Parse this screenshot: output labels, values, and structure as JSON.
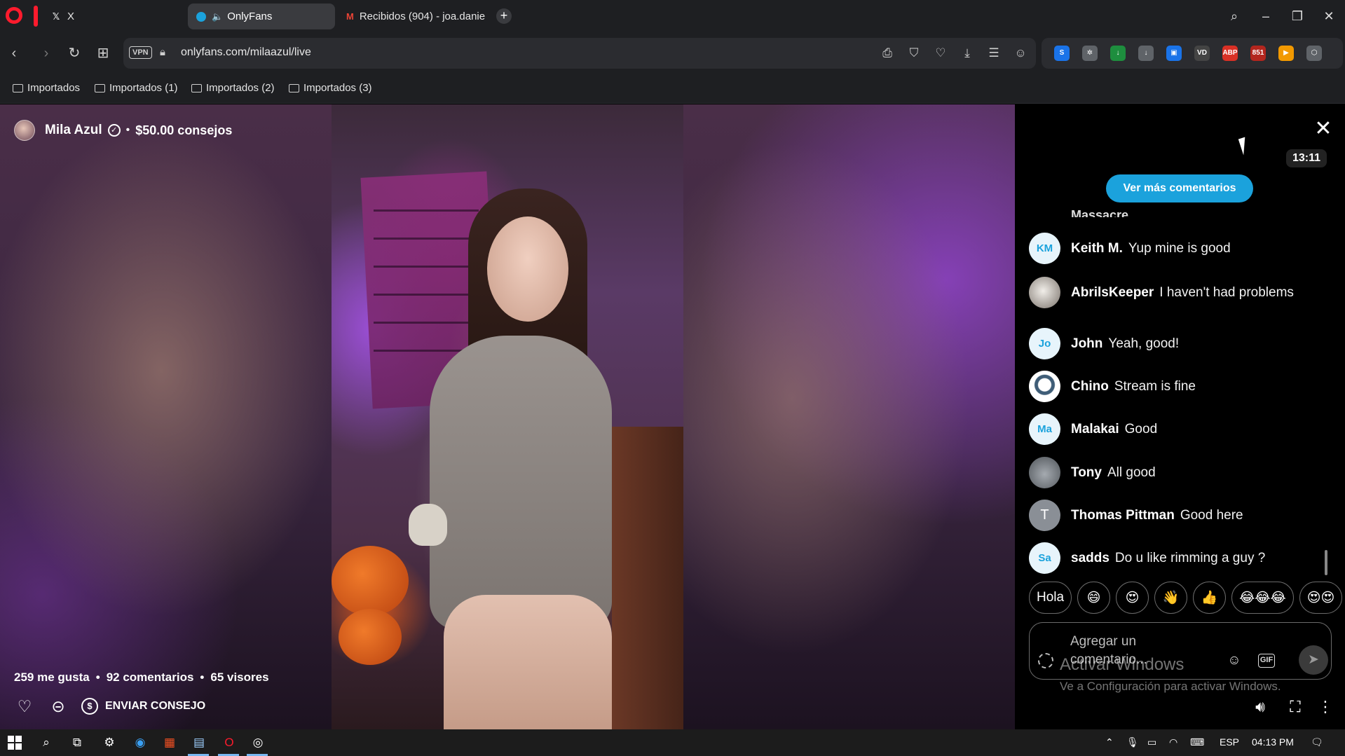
{
  "tabs": [
    {
      "label": "X",
      "favicon": "x-logo"
    },
    {
      "label": "OnlyFans",
      "favicon": "onlyfans-logo",
      "audio": true,
      "active": true
    },
    {
      "label": "Recibidos (904) - joa.danie",
      "favicon": "gmail-logo"
    }
  ],
  "address_bar": {
    "vpn_label": "VPN",
    "url": "onlyfans.com/milaazul/live"
  },
  "extensions": [
    {
      "name": "ext-blue-swirl",
      "color": "#1a73e8",
      "text": "S"
    },
    {
      "name": "ext-gear",
      "color": "#5f6368",
      "text": "✲"
    },
    {
      "name": "ext-download-green",
      "color": "#1e8e3e",
      "text": "↓"
    },
    {
      "name": "ext-download-grey",
      "color": "#5f6368",
      "text": "↓"
    },
    {
      "name": "ext-screen",
      "color": "#1a73e8",
      "text": "▣"
    },
    {
      "name": "ext-vd",
      "color": "#444",
      "text": "VD"
    },
    {
      "name": "ext-adblock-plus",
      "color": "#d93025",
      "text": "ABP"
    },
    {
      "name": "ext-counter",
      "color": "#b3261e",
      "text": "851"
    },
    {
      "name": "ext-play",
      "color": "#f29900",
      "text": "▶"
    },
    {
      "name": "ext-cube",
      "color": "#5f6368",
      "text": "⬡"
    }
  ],
  "bookmarks": [
    "Importados",
    "Importados (1)",
    "Importados (2)",
    "Importados (3)"
  ],
  "stream": {
    "streamer_name": "Mila Azul",
    "tips_total": "$50.00 consejos",
    "likes": "259 me gusta",
    "comments_count": "92 comentarios",
    "viewers": "65 visores",
    "tip_button": "ENVIAR CONSEJO"
  },
  "chat": {
    "timer": "13:11",
    "more_comments": "Ver más comentarios",
    "truncated_text": "Massacre",
    "comments": [
      {
        "initials": "KM",
        "avatar": "initials",
        "user": "Keith M.",
        "text": "Yup mine is good"
      },
      {
        "initials": "",
        "avatar": "photo-cat",
        "user": "AbrilsKeeper",
        "text": "I haven't had problems"
      },
      {
        "initials": "Jo",
        "avatar": "initials",
        "user": "John",
        "text": "Yeah, good!"
      },
      {
        "initials": "",
        "avatar": "photo-eye",
        "user": "Chino",
        "text": "Stream is fine"
      },
      {
        "initials": "Ma",
        "avatar": "initials",
        "user": "Malakai",
        "text": "Good"
      },
      {
        "initials": "",
        "avatar": "photo-landscape",
        "user": "Tony",
        "text": "All good"
      },
      {
        "initials": "T",
        "avatar": "grey",
        "user": "Thomas Pittman",
        "text": "Good here"
      },
      {
        "initials": "Sa",
        "avatar": "initials",
        "user": "sadds",
        "text": "Do u like rimming a guy ?"
      }
    ],
    "quick_replies": [
      "Hola",
      "😄",
      "😍",
      "👋",
      "👍",
      "😂😂😂",
      "😍😍"
    ],
    "input_placeholder": "Agregar un comentario...",
    "gif_label": "GIF"
  },
  "watermark": {
    "title": "Activar Windows",
    "subtitle": "Ve a Configuración para activar Windows."
  },
  "taskbar": {
    "language": "ESP",
    "time": "04:13 PM"
  }
}
